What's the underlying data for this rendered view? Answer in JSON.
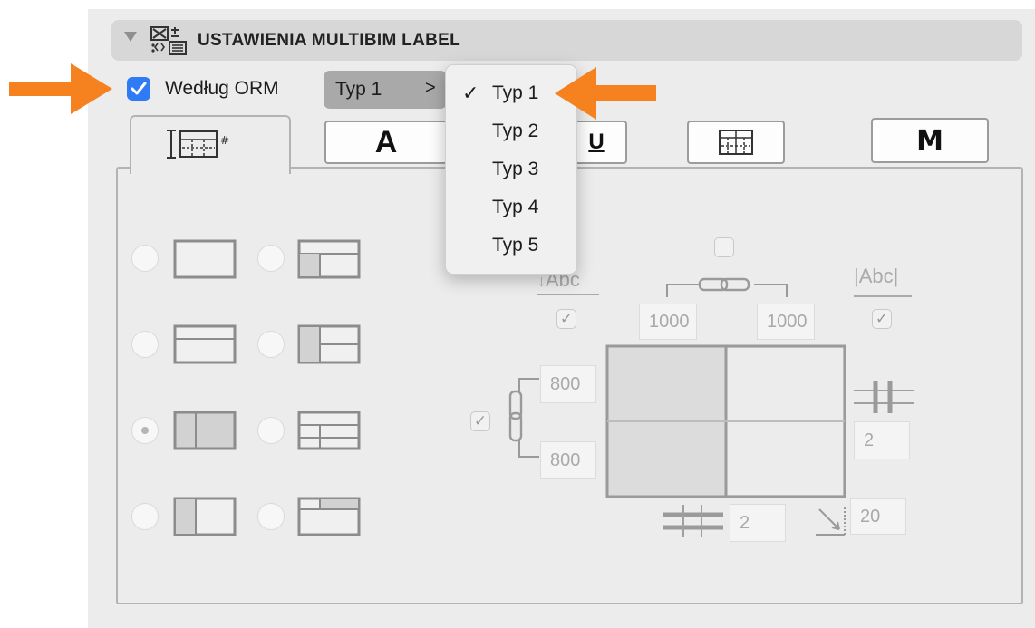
{
  "header": {
    "title": "USTAWIENIA MULTIBIM LABEL"
  },
  "options": {
    "by_orm_label": "Według ORM",
    "by_orm_checked": true,
    "type_popup_value": "Typ 1",
    "type_popup_chevron": ">"
  },
  "type_menu": {
    "items": [
      {
        "label": "Typ 1",
        "checked": true
      },
      {
        "label": "Typ 2",
        "checked": false
      },
      {
        "label": "Typ 3",
        "checked": false
      },
      {
        "label": "Typ 4",
        "checked": false
      },
      {
        "label": "Typ 5",
        "checked": false
      }
    ],
    "checkmark": "✓"
  },
  "tabs": {
    "text_tab_glyph": "A",
    "underline_tab_glyph": "U",
    "marker_tab_glyph": "M"
  },
  "layout_panel": {
    "text_sample": "Abc",
    "width_left": "1000",
    "width_right": "1000",
    "height_top": "800",
    "height_bottom": "800",
    "vertical_divisions": "2",
    "horizontal_divisions": "2",
    "corner_radius": "20",
    "check_glyph": "✓"
  },
  "colors": {
    "accent_arrow": "#f5821f",
    "checkbox_blue": "#2f7bf5",
    "panel_bg": "#ececec"
  }
}
